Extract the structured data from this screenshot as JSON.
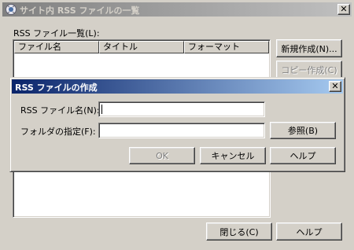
{
  "main": {
    "title": "サイト内 RSS ファイルの一覧",
    "close_symbol": "✕",
    "list_label": "RSS ファイル一覧(L):",
    "columns": [
      "ファイル名",
      "タイトル",
      "フォーマット"
    ],
    "buttons": {
      "new": "新規作成(N)...",
      "copy": "コピー作成(C)",
      "close": "閉じる(C)",
      "help": "ヘルプ"
    }
  },
  "dialog": {
    "title": "RSS ファイルの作成",
    "close_symbol": "✕",
    "name_label": "RSS ファイル名(N):",
    "name_value": "",
    "folder_label": "フォルダの指定(F):",
    "folder_value": "",
    "buttons": {
      "browse": "参照(B)",
      "ok": "OK",
      "cancel": "キャンセル",
      "help": "ヘルプ"
    }
  }
}
